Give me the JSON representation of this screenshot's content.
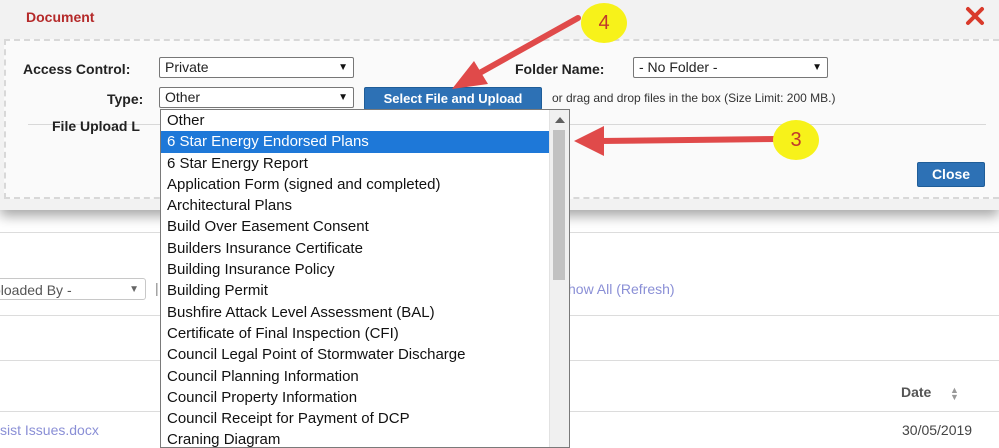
{
  "background": {
    "uploader_filter": "ploaded By -",
    "pipe": "|",
    "show_all_link": "how All (Refresh)",
    "date_header": "Date",
    "file_name": "sist Issues.docx",
    "file_date": "30/05/2019"
  },
  "modal": {
    "title": "Document",
    "access_control_label": "Access Control:",
    "access_control_value": "Private",
    "type_label": "Type:",
    "type_value": "Other",
    "folder_label": "Folder Name:",
    "folder_value": "- No Folder -",
    "upload_button": "Select File and Upload",
    "drag_hint": "or drag and drop files in the box (Size Limit: 200 MB.)",
    "file_upload_label": "File Upload L",
    "close_button": "Close"
  },
  "dropdown": {
    "highlighted_index": 1,
    "options": [
      "Other",
      "6 Star Energy Endorsed Plans",
      "6 Star Energy Report",
      "Application Form (signed and completed)",
      "Architectural Plans",
      "Build Over Easement Consent",
      "Builders Insurance Certificate",
      "Building Insurance Policy",
      "Building Permit",
      "Bushfire Attack Level Assessment (BAL)",
      "Certificate of Final Inspection (CFI)",
      "Council Legal Point of Stormwater Discharge",
      "Council Planning Information",
      "Council Property Information",
      "Council Receipt for Payment of DCP",
      "Craning Diagram"
    ]
  },
  "annotations": {
    "step_4": "4",
    "step_3": "3",
    "arrow_color": "#e04a4a",
    "bubble_color": "#f7f21a"
  },
  "colors": {
    "title_red": "#b52a2a",
    "button_blue": "#2d71b5",
    "highlight_blue": "#1e78d8",
    "link_purple": "#8a8fd6"
  }
}
